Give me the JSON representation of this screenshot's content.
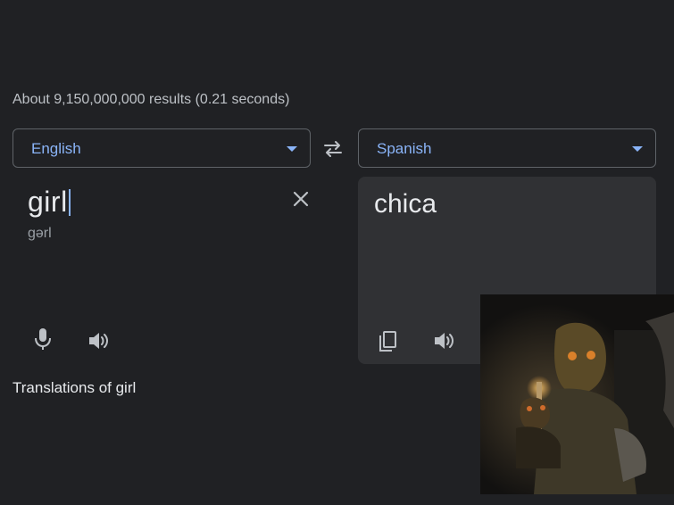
{
  "search": {
    "results_stats": "About 9,150,000,000 results (0.21 seconds)"
  },
  "translate": {
    "source_language": "English",
    "target_language": "Spanish",
    "source_text": "girl",
    "source_transliteration": "gərl",
    "translated_text": "chica",
    "translations_heading": "Translations of girl"
  },
  "colors": {
    "background": "#202124",
    "panel": "#303134",
    "accent": "#8ab4f8",
    "text_primary": "#e8eaed",
    "text_secondary": "#9aa0a6"
  },
  "icons": {
    "swap": "swap-horiz-icon",
    "clear": "close-icon",
    "mic": "microphone-icon",
    "speak": "volume-icon",
    "copy": "copy-icon",
    "dropdown": "caret-down-icon"
  }
}
